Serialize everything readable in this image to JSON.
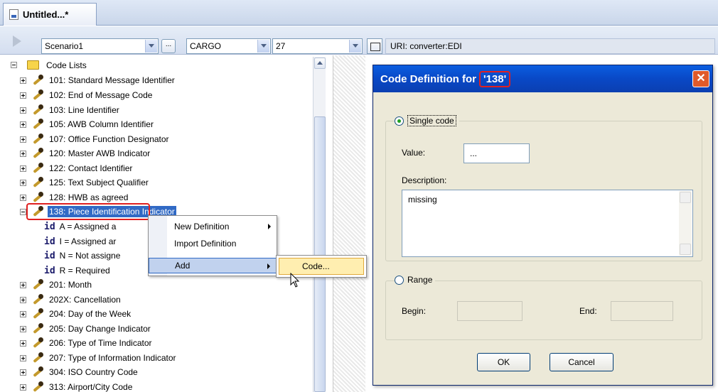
{
  "tab": {
    "title": "Untitled...*"
  },
  "toolbar": {
    "scenario": "Scenario1",
    "dots_label": "...",
    "standard": "CARGO",
    "version": "27",
    "uri_prefix": "URI:",
    "uri_value": "converter:EDI"
  },
  "tree": {
    "root_label": "Code Lists",
    "items_before": [
      "101: Standard Message Identifier",
      "102: End of Message Code",
      "103: Line Identifier",
      "105: AWB Column Identifier",
      "107: Office Function Designator",
      "120: Master AWB Indicator",
      "122: Contact Identifier",
      "125: Text Subject Qualifier",
      "128: HWB as agreed"
    ],
    "selected_item": "138: Piece Identification Indicator",
    "id_tag": "id",
    "children": [
      "A = Assigned a",
      "I = Assigned ar",
      "N = Not assigne",
      "R = Required"
    ],
    "items_after": [
      "201: Month",
      "202X: Cancellation",
      "204: Day of the Week",
      "205: Day Change Indicator",
      "206: Type of Time Indicator",
      "207: Type of Information Indicator",
      "304: ISO Country Code",
      "313: Airport/City Code"
    ]
  },
  "context_menu": {
    "items": [
      "New Definition",
      "Import Definition",
      "Add"
    ],
    "submenu_item": "Code..."
  },
  "dialog": {
    "title": "Code Definition for",
    "title_code": "'138'",
    "single_code_label": "Single code",
    "value_label": "Value:",
    "value": "...",
    "description_label": "Description:",
    "description": "missing",
    "range_label": "Range",
    "begin_label": "Begin:",
    "end_label": "End:",
    "ok_label": "OK",
    "cancel_label": "Cancel",
    "close_glyph": "✕"
  }
}
